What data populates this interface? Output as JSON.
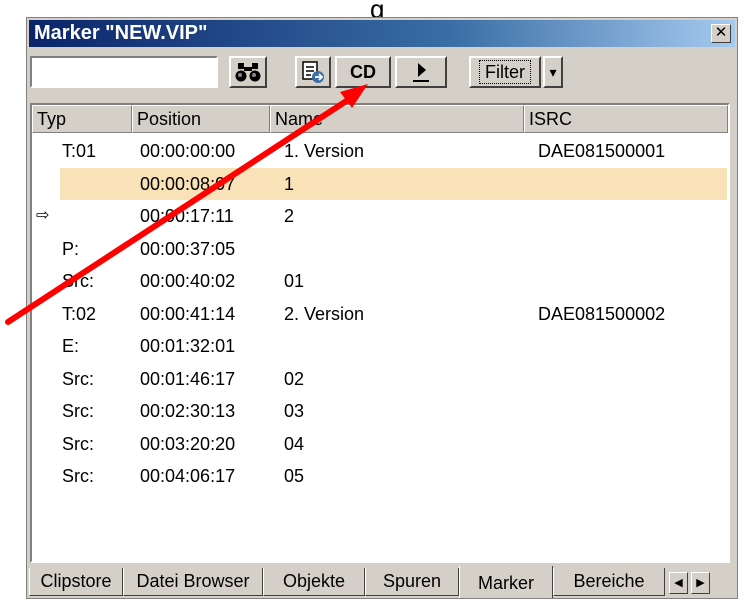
{
  "top_label": "g",
  "window": {
    "title": "Marker \"NEW.VIP\"",
    "close_glyph": "✕"
  },
  "toolbar": {
    "search_value": "",
    "cd_label": "CD",
    "filter_label": "Filter",
    "dropdown_glyph": "▾",
    "find_icon": "binoculars-icon",
    "export_icon": "list-export-icon",
    "play_icon": "play-icon"
  },
  "columns": [
    "Typ",
    "Position",
    "Name",
    "ISRC"
  ],
  "rows": [
    {
      "typ": "T:01",
      "position": "00:00:00:00",
      "name": "1. Version",
      "isrc": "DAE081500001",
      "marker": ""
    },
    {
      "typ": "",
      "position": "00:00:08:07",
      "name": "1",
      "isrc": "",
      "marker": ""
    },
    {
      "typ": "",
      "position": "00:00:17:11",
      "name": "2",
      "isrc": "",
      "marker": "⇨"
    },
    {
      "typ": "P:",
      "position": "00:00:37:05",
      "name": "",
      "isrc": "",
      "marker": ""
    },
    {
      "typ": "Src:",
      "position": "00:00:40:02",
      "name": "01",
      "isrc": "",
      "marker": ""
    },
    {
      "typ": "T:02",
      "position": "00:00:41:14",
      "name": "2. Version",
      "isrc": "DAE081500002",
      "marker": ""
    },
    {
      "typ": "E:",
      "position": "00:01:32:01",
      "name": "",
      "isrc": "",
      "marker": ""
    },
    {
      "typ": "Src:",
      "position": "00:01:46:17",
      "name": "02",
      "isrc": "",
      "marker": ""
    },
    {
      "typ": "Src:",
      "position": "00:02:30:13",
      "name": "03",
      "isrc": "",
      "marker": ""
    },
    {
      "typ": "Src:",
      "position": "00:03:20:20",
      "name": "04",
      "isrc": "",
      "marker": ""
    },
    {
      "typ": "Src:",
      "position": "00:04:06:17",
      "name": "05",
      "isrc": "",
      "marker": ""
    }
  ],
  "selected_row": 1,
  "tabs": [
    "Clipstore",
    "Datei Browser",
    "Objekte",
    "Spuren",
    "Marker",
    "Bereiche"
  ],
  "active_tab": "Marker",
  "tab_scroll": {
    "left_glyph": "◀",
    "right_glyph": "▶"
  },
  "colors": {
    "selection": "#fae2b8",
    "annotation_arrow": "#ff0000",
    "titlebar": "#0a246a"
  }
}
